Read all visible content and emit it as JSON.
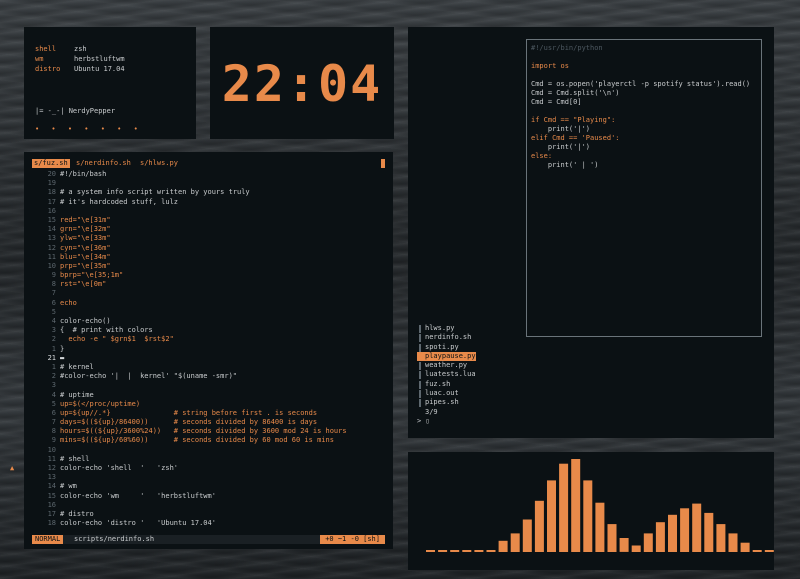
{
  "info": {
    "rows": [
      {
        "key": "shell",
        "value": "zsh"
      },
      {
        "key": "wm",
        "value": "herbstluftwm"
      },
      {
        "key": "distro",
        "value": "Ubuntu 17.04"
      }
    ],
    "tag": "|= -_-| NerdyPepper",
    "dots": "• • • • • • •"
  },
  "clock": {
    "time": "22:04"
  },
  "editor": {
    "tabs": [
      "s/fuz.sh",
      "s/nerdinfo.sh",
      "s/hlws.py"
    ],
    "active_tab": 1,
    "lines": [
      {
        "n": "20",
        "t": "#!/bin/bash"
      },
      {
        "n": "19",
        "t": ""
      },
      {
        "n": "18",
        "t": "# a system info script written by yours truly"
      },
      {
        "n": "17",
        "t": "# it's hardcoded stuff, lulz"
      },
      {
        "n": "16",
        "t": ""
      },
      {
        "n": "15",
        "t": "red=\"\\e[31m\""
      },
      {
        "n": "14",
        "t": "grn=\"\\e[32m\""
      },
      {
        "n": "13",
        "t": "ylw=\"\\e[33m\""
      },
      {
        "n": "12",
        "t": "cyn=\"\\e[36m\""
      },
      {
        "n": "11",
        "t": "blu=\"\\e[34m\""
      },
      {
        "n": "10",
        "t": "prp=\"\\e[35m\""
      },
      {
        "n": "9",
        "t": "bprp=\"\\e[35;1m\""
      },
      {
        "n": "8",
        "t": "rst=\"\\e[0m\""
      },
      {
        "n": "7",
        "t": ""
      },
      {
        "n": "6",
        "t": "echo"
      },
      {
        "n": "5",
        "t": ""
      },
      {
        "n": "4",
        "t": "color-echo()"
      },
      {
        "n": "3",
        "t": "{  # print with colors"
      },
      {
        "n": "2",
        "t": "  echo -e \" $grn$1  $rst$2\""
      },
      {
        "n": "1",
        "t": "}"
      },
      {
        "n": "21",
        "t": "",
        "cur": true
      },
      {
        "n": "1",
        "t": "# kernel"
      },
      {
        "n": "2",
        "t": "#color-echo '|  |  kernel' \"$(uname -smr)\""
      },
      {
        "n": "3",
        "t": ""
      },
      {
        "n": "4",
        "t": "# uptime"
      },
      {
        "n": "5",
        "t": "up=$(</proc/uptime)"
      },
      {
        "n": "6",
        "t": "up=${up//.*}               # string before first . is seconds"
      },
      {
        "n": "7",
        "t": "days=$((${up}/86400))      # seconds divided by 86400 is days"
      },
      {
        "n": "8",
        "t": "hours=$((${up}/3600%24))   # seconds divided by 3600 mod 24 is hours"
      },
      {
        "n": "9",
        "t": "mins=$((${up}/60%60))      # seconds divided by 60 mod 60 is mins"
      },
      {
        "n": "10",
        "t": ""
      },
      {
        "n": "11",
        "t": "# shell"
      },
      {
        "n": "12",
        "t": "color-echo 'shell  '   'zsh'",
        "mark": "▲"
      },
      {
        "n": "13",
        "t": ""
      },
      {
        "n": "14",
        "t": "# wm"
      },
      {
        "n": "15",
        "t": "color-echo 'wm     '   'herbstluftwm'"
      },
      {
        "n": "16",
        "t": ""
      },
      {
        "n": "17",
        "t": "# distro"
      },
      {
        "n": "18",
        "t": "color-echo 'distro '   'Ubuntu 17.04'"
      }
    ],
    "status": {
      "mode": "NORMAL",
      "file": "scripts/nerdinfo.sh",
      "right": "+0 ~1 -0    [sh]"
    }
  },
  "python": {
    "lines": [
      {
        "t": "#!/usr/bin/python",
        "c": "dim"
      },
      {
        "t": "",
        "c": "light"
      },
      {
        "t": "import os",
        "c": "orange"
      },
      {
        "t": "",
        "c": "light"
      },
      {
        "t": "Cmd = os.popen('playerctl -p spotify status').read()",
        "c": "light"
      },
      {
        "t": "Cmd = Cmd.split('\\n')",
        "c": "light"
      },
      {
        "t": "Cmd = Cmd[0]",
        "c": "light"
      },
      {
        "t": "",
        "c": "light"
      },
      {
        "t": "if Cmd == \"Playing\":",
        "c": "orange"
      },
      {
        "t": "    print('|')",
        "c": "light"
      },
      {
        "t": "elif Cmd == 'Paused':",
        "c": "orange"
      },
      {
        "t": "    print('|')",
        "c": "light"
      },
      {
        "t": "else:",
        "c": "orange"
      },
      {
        "t": "    print(' | ')",
        "c": "light"
      }
    ]
  },
  "files": {
    "items": [
      "hlws.py",
      "nerdinfo.sh",
      "spoti.py",
      "playpause.py",
      "weather.py",
      "luatests.lua",
      "fuz.sh",
      "luac.out",
      "pipes.sh"
    ],
    "selected": 3,
    "count": "3/9",
    "prompt": ">"
  },
  "visualizer": {
    "levels": [
      0,
      0,
      0,
      0,
      0,
      0,
      0.12,
      0.2,
      0.35,
      0.55,
      0.77,
      0.95,
      1.0,
      0.77,
      0.53,
      0.3,
      0.15,
      0.07,
      0.2,
      0.32,
      0.4,
      0.47,
      0.52,
      0.42,
      0.3,
      0.2,
      0.1,
      0,
      0,
      0,
      0,
      0
    ],
    "color": "#e88a4a"
  },
  "colors": {
    "accent": "#e88a4a",
    "panel": "#0b1114",
    "text": "#c9ccce"
  }
}
